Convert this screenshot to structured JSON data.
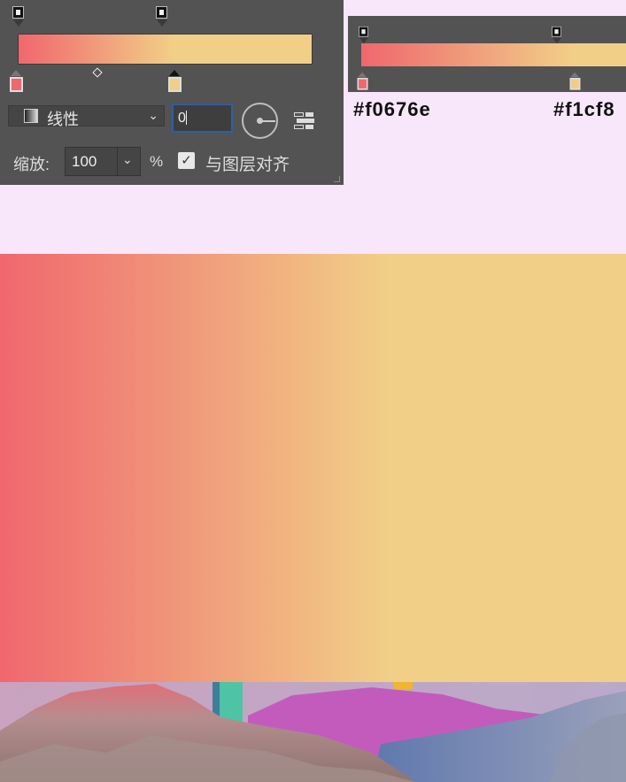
{
  "colors": {
    "start": "#f0676e",
    "end": "#f1cf87",
    "panel_bg": "#535353",
    "canvas_bg": "#f8e6fb"
  },
  "gradient_editor": {
    "type_label": "线性",
    "angle_value": "0",
    "scale_label": "缩放:",
    "scale_value": "100",
    "scale_unit": "%",
    "align_with_layer_label": "与图层对齐",
    "align_with_layer_checked": true,
    "dropdown_icon": "chevron-down-icon",
    "checkmark": "✓"
  },
  "color_stops": [
    {
      "hex": "#f0676e",
      "location": 0
    },
    {
      "hex": "#f1cf87",
      "location": 53
    }
  ],
  "midpoint_location": 27,
  "preview_labels": {
    "start_hex": "#f0676e",
    "end_hex": "#f1cf8"
  }
}
